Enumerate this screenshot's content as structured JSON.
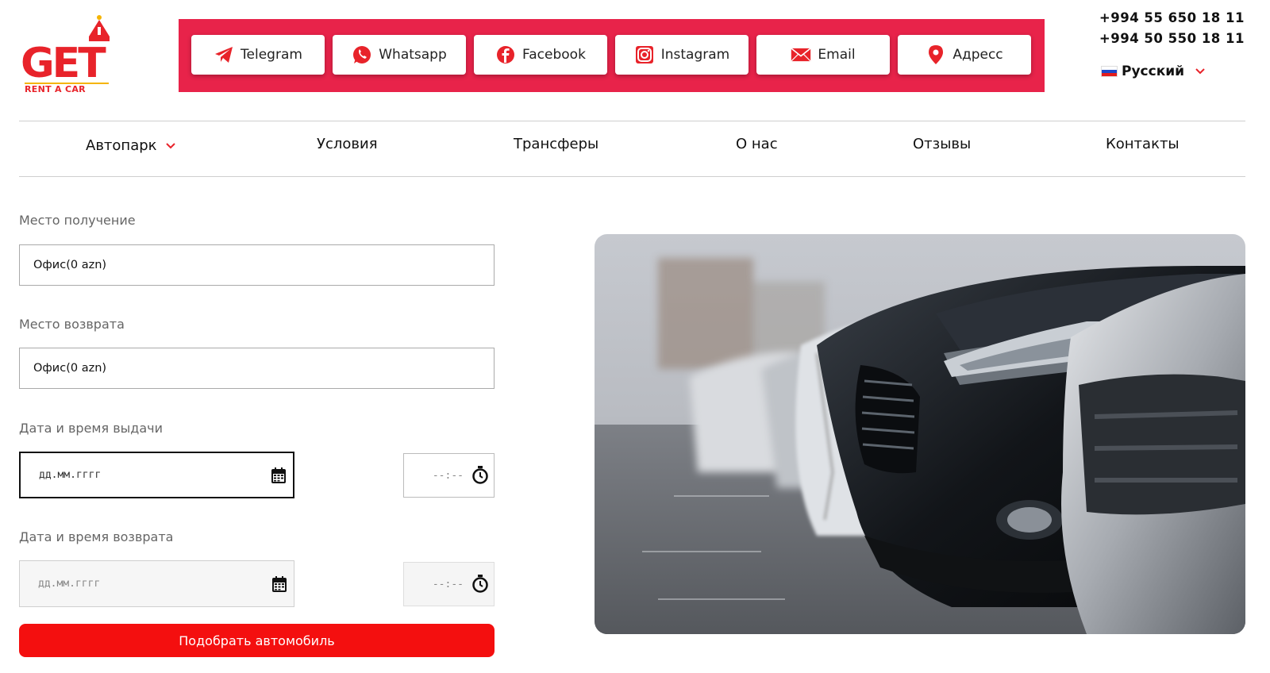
{
  "logo": {
    "brand": "GET",
    "tagline": "RENT A CAR"
  },
  "social": [
    {
      "label": "Telegram",
      "icon": "telegram-icon"
    },
    {
      "label": "Whatsapp",
      "icon": "whatsapp-icon"
    },
    {
      "label": "Facebook",
      "icon": "facebook-icon"
    },
    {
      "label": "Instagram",
      "icon": "instagram-icon"
    },
    {
      "label": "Email",
      "icon": "email-icon"
    },
    {
      "label": "Адресс",
      "icon": "location-pin-icon"
    }
  ],
  "phones": [
    "+994 55 650 18 11",
    "+994 50 550 18 11"
  ],
  "language": {
    "label": "Русский",
    "flag": "ru-flag-icon"
  },
  "nav": [
    {
      "label": "Автопарк",
      "has_dropdown": true
    },
    {
      "label": "Условия"
    },
    {
      "label": "Трансферы"
    },
    {
      "label": "О нас"
    },
    {
      "label": "Отзывы"
    },
    {
      "label": "Контакты"
    }
  ],
  "form": {
    "pickup_label": "Место получение",
    "pickup_value": "Офис(0 azn)",
    "return_label": "Место возврата",
    "return_value": "Офис(0 azn)",
    "pickup_datetime_label": "Дата и время выдачи",
    "return_datetime_label": "Дата и время возврата",
    "date_placeholder": "дд.мм.гггг",
    "time_placeholder": "--:--",
    "submit_label": "Подобрать автомобиль"
  },
  "colors": {
    "brand_red": "#e8232a",
    "social_bar": "#e8234a",
    "button_red": "#f40f0f"
  }
}
